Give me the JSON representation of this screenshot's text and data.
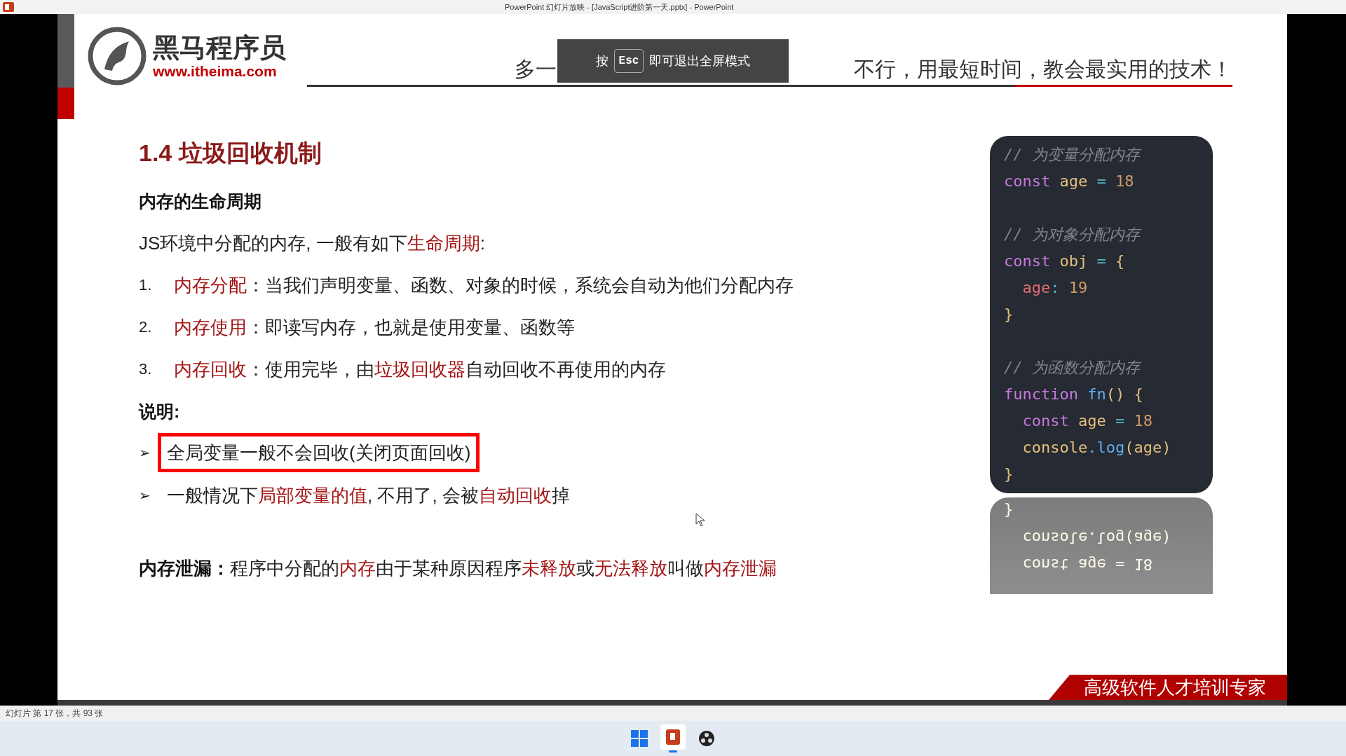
{
  "window": {
    "title": "PowerPoint 幻灯片放映 - [JavaScript进阶第一天.pptx] - PowerPoint"
  },
  "slide": {
    "logo": {
      "name": "黑马程序员",
      "url": "www.itheima.com"
    },
    "slogan": {
      "visible_start": "多一",
      "visible_end": "不行，用最短时间，教会最实用的技术！"
    },
    "title": "1.4 垃圾回收机制",
    "heading": "内存的生命周期",
    "intro": [
      {
        "text": "JS环境中分配的内存, 一般有如下",
        "red": false
      },
      {
        "text": "生命周期",
        "red": true
      },
      {
        "text": ":",
        "red": false
      }
    ],
    "steps": [
      {
        "number": "1.",
        "segments": [
          {
            "text": "内存分配",
            "red": true
          },
          {
            "text": "：当我们声明变量、函数、对象的时候，系统会自动为他们分配内存",
            "red": false
          }
        ]
      },
      {
        "number": "2.",
        "segments": [
          {
            "text": "内存使用",
            "red": true
          },
          {
            "text": "：即读写内存，也就是使用变量、函数等",
            "red": false
          }
        ]
      },
      {
        "number": "3.",
        "segments": [
          {
            "text": "内存回收",
            "red": true
          },
          {
            "text": "：使用完毕，由",
            "red": false
          },
          {
            "text": "垃圾回收器",
            "red": true
          },
          {
            "text": "自动回收不再使用的内存",
            "red": false
          }
        ]
      }
    ],
    "note_heading": "说明:",
    "notes": [
      {
        "bullet": "➢",
        "highlighted": true,
        "segments": [
          {
            "text": "全局变量一般不会回收(关闭页面回收)",
            "red": false
          }
        ]
      },
      {
        "bullet": "➢",
        "highlighted": false,
        "segments": [
          {
            "text": "一般情况下",
            "red": false
          },
          {
            "text": "局部变量的值",
            "red": true
          },
          {
            "text": ", 不用了, 会被",
            "red": false
          },
          {
            "text": "自动回收",
            "red": true
          },
          {
            "text": "掉",
            "red": false
          }
        ]
      }
    ],
    "leak": [
      {
        "text": "内存泄漏：",
        "red": false,
        "bold": true
      },
      {
        "text": "程序中分配的",
        "red": false
      },
      {
        "text": "内存",
        "red": true
      },
      {
        "text": "由于某种原因程序",
        "red": false
      },
      {
        "text": "未释放",
        "red": true
      },
      {
        "text": "或",
        "red": false
      },
      {
        "text": "无法释放",
        "red": true
      },
      {
        "text": "叫做",
        "red": false
      },
      {
        "text": "内存泄漏",
        "red": true
      }
    ],
    "code_blocks": [
      [
        [
          {
            "kind": "comment",
            "text": "// 为变量分配内存"
          }
        ],
        [
          {
            "kind": "keyword",
            "text": "const"
          },
          {
            "kind": "variable",
            "text": " age"
          },
          {
            "kind": "operator",
            "text": " ="
          },
          {
            "kind": "number",
            "text": " 18"
          }
        ]
      ],
      [
        [
          {
            "kind": "comment",
            "text": "// 为对象分配内存"
          }
        ],
        [
          {
            "kind": "keyword",
            "text": "const"
          },
          {
            "kind": "variable",
            "text": " obj"
          },
          {
            "kind": "operator",
            "text": " ="
          },
          {
            "kind": "punct",
            "text": " {"
          }
        ],
        [
          {
            "kind": "property",
            "text": "  age"
          },
          {
            "kind": "operator",
            "text": ":"
          },
          {
            "kind": "number",
            "text": " 19"
          }
        ],
        [
          {
            "kind": "punct",
            "text": "}"
          }
        ]
      ],
      [
        [
          {
            "kind": "comment",
            "text": "// 为函数分配内存"
          }
        ],
        [
          {
            "kind": "keyword",
            "text": "function"
          },
          {
            "kind": "function",
            "text": " fn"
          },
          {
            "kind": "punct",
            "text": "() {"
          }
        ],
        [
          {
            "kind": "keyword",
            "text": "  const"
          },
          {
            "kind": "variable",
            "text": " age"
          },
          {
            "kind": "operator",
            "text": " ="
          },
          {
            "kind": "number",
            "text": " 18"
          }
        ],
        [
          {
            "kind": "variable",
            "text": "  console"
          },
          {
            "kind": "operator",
            "text": "."
          },
          {
            "kind": "function",
            "text": "log"
          },
          {
            "kind": "punct",
            "text": "("
          },
          {
            "kind": "variable",
            "text": "age"
          },
          {
            "kind": "punct",
            "text": ")"
          }
        ],
        [
          {
            "kind": "punct",
            "text": "}"
          }
        ]
      ]
    ],
    "reflection": [
      "}",
      "  console.log(age)",
      "  const age = 18"
    ],
    "badge": "高级软件人才培训专家"
  },
  "fullscreen_toast": {
    "prefix": "按",
    "key": "Esc",
    "suffix": "即可退出全屏模式"
  },
  "status_bar": {
    "slide_info": "幻灯片 第 17 张，共 93 张"
  }
}
